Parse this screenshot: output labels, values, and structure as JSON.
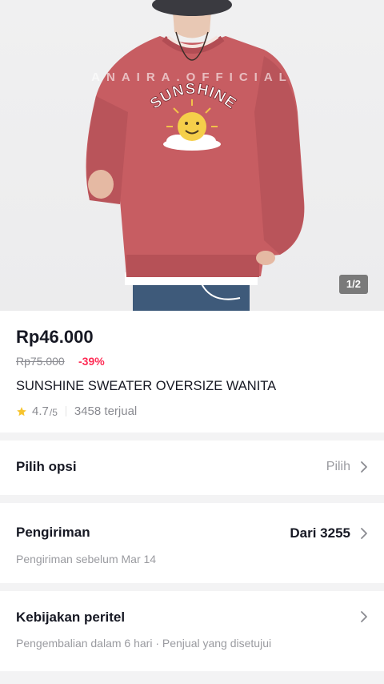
{
  "gallery": {
    "watermark": "ANAIRA.OFFICIAL",
    "print_text": "SUNSHINE",
    "counter": "1/2"
  },
  "product": {
    "price": "Rp46.000",
    "original_price": "Rp75.000",
    "discount": "-39%",
    "title": "SUNSHINE SWEATER OVERSIZE WANITA",
    "rating": "4.7",
    "rating_max": "/5",
    "sold": "3458 terjual"
  },
  "options": {
    "label": "Pilih opsi",
    "action": "Pilih"
  },
  "shipping": {
    "label": "Pengiriman",
    "value": "Dari 3255",
    "note": "Pengiriman sebelum Mar 14"
  },
  "policy": {
    "label": "Kebijakan peritel",
    "note": "Pengembalian dalam 6 hari · Penjual yang disetujui"
  },
  "colors": {
    "sweater": "#c75d62",
    "accent_red": "#fe2c55",
    "star": "#f7c42e"
  }
}
